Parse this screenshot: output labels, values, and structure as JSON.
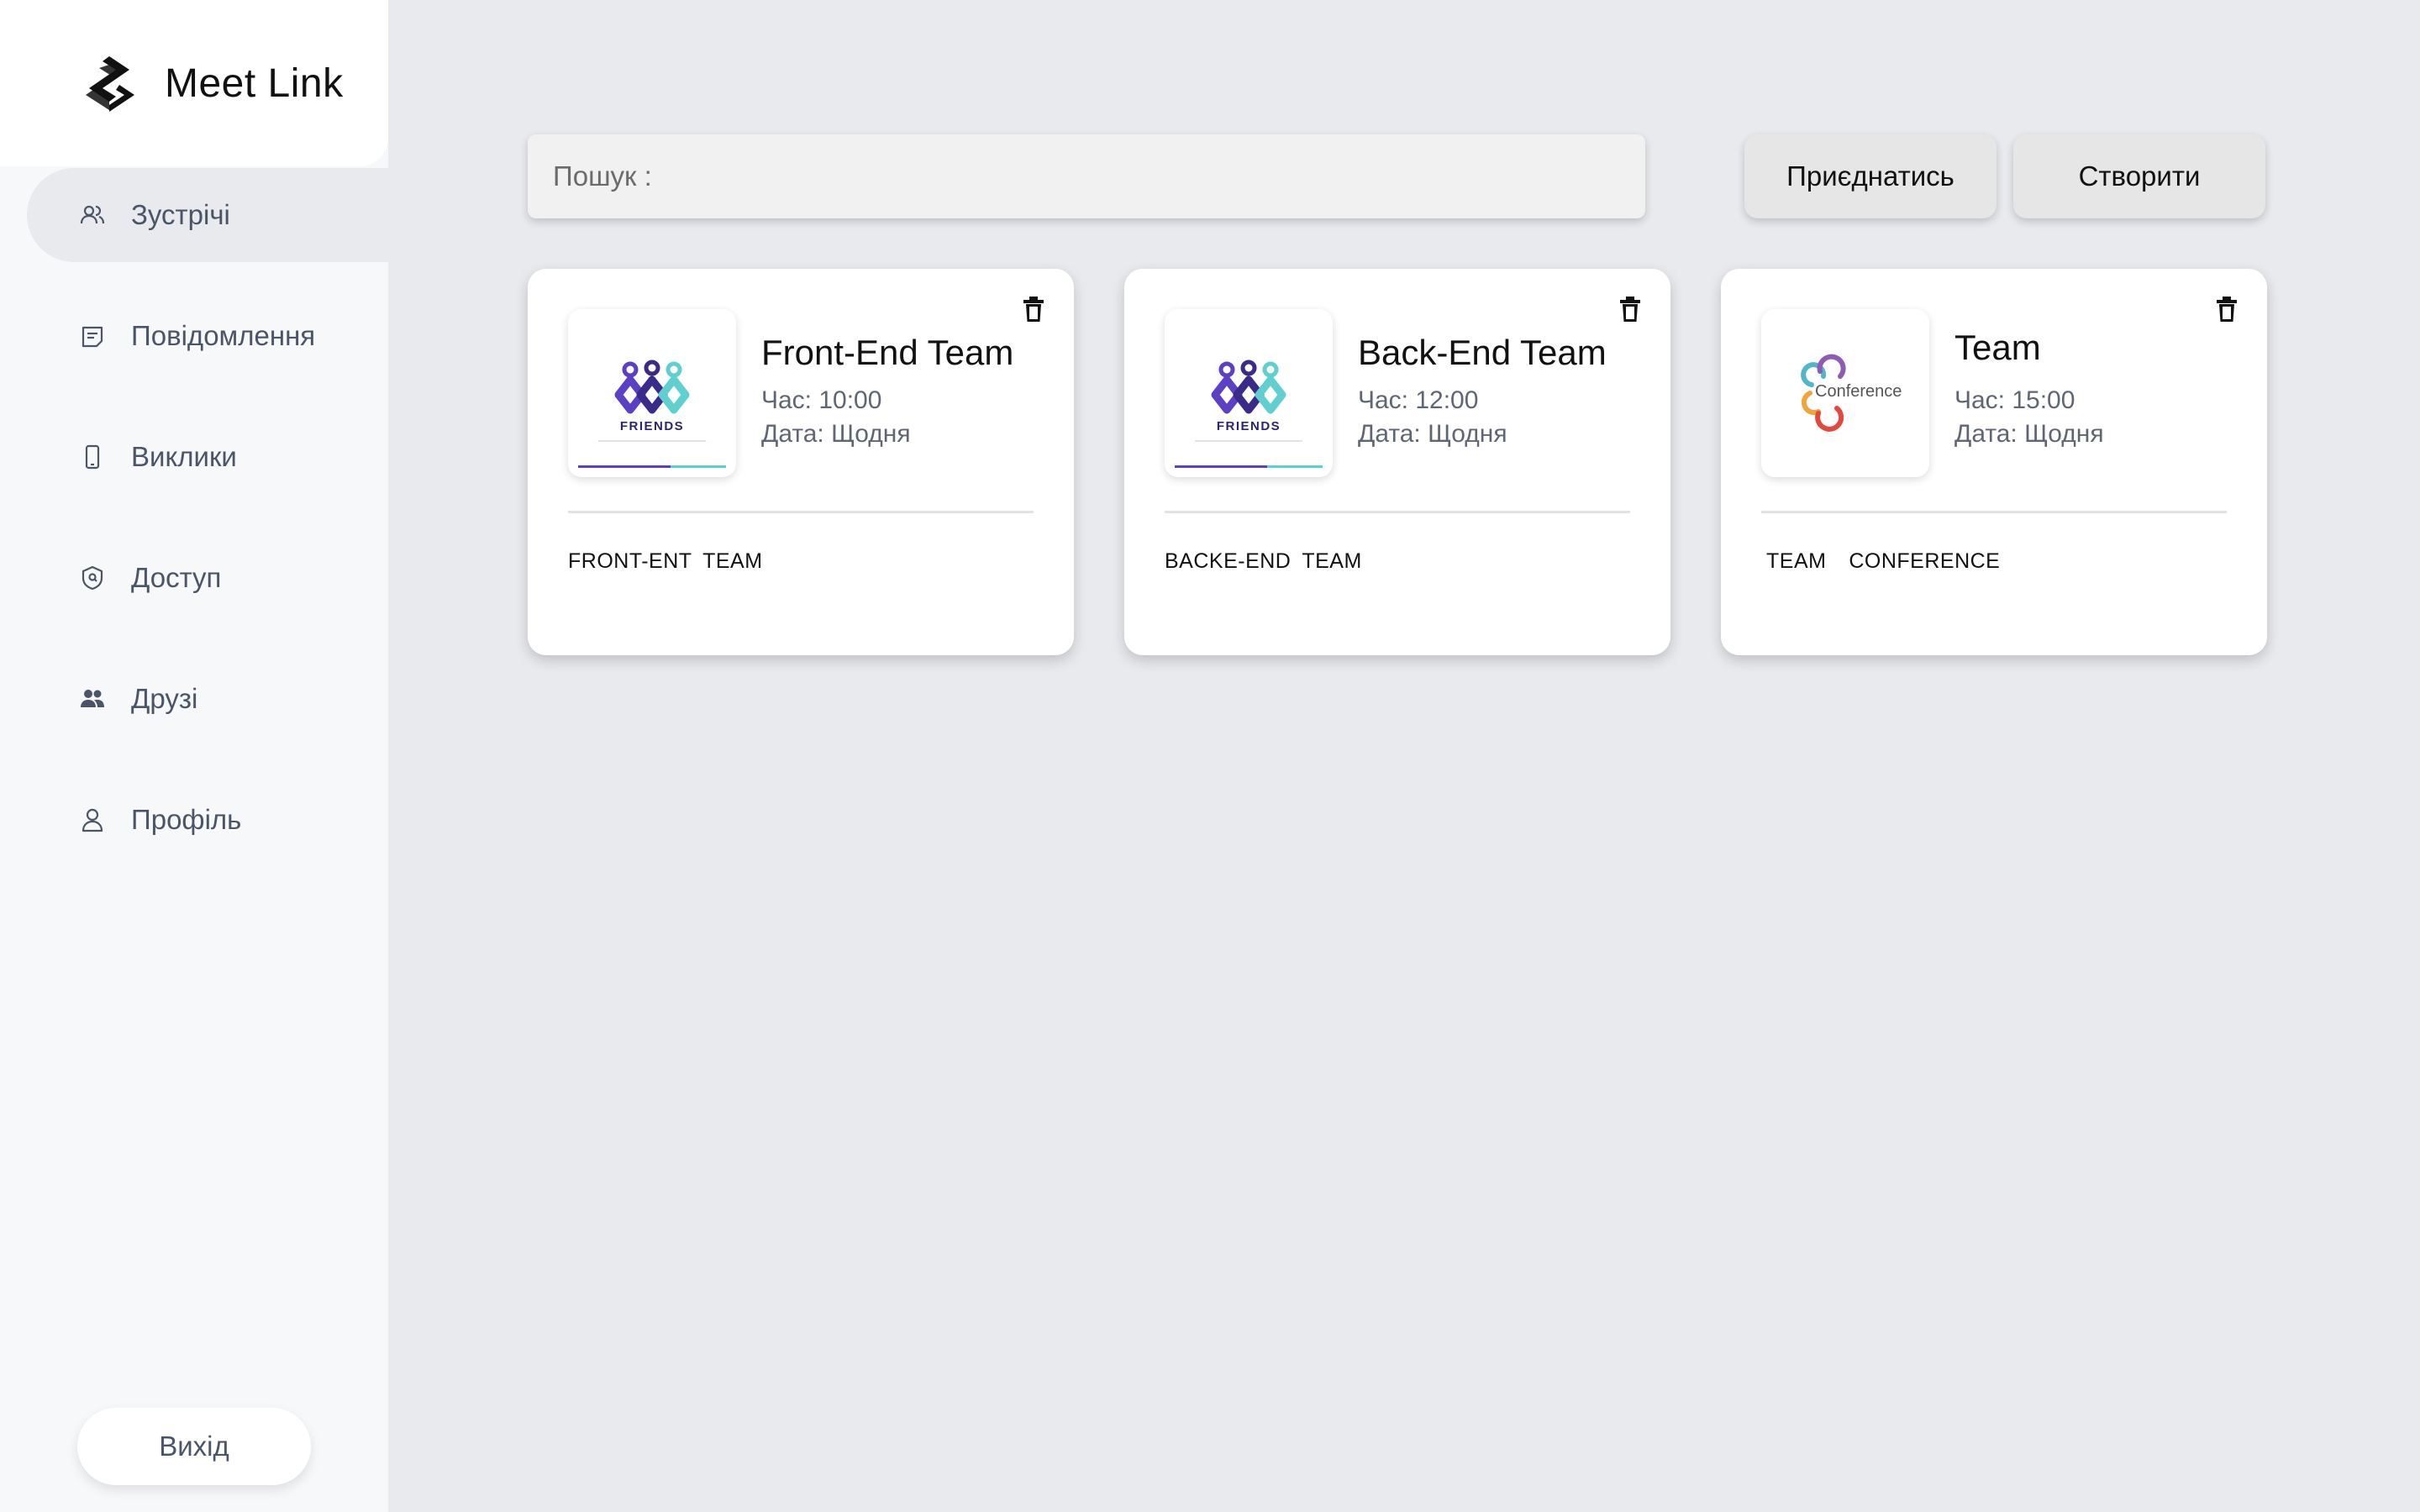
{
  "app": {
    "name": "Meet Link",
    "logo_icon": "meet-link-logo"
  },
  "sidebar": {
    "items": [
      {
        "label": "Зустрічі",
        "icon": "people-outline-icon",
        "active": true
      },
      {
        "label": "Повідомлення",
        "icon": "message-icon",
        "active": false
      },
      {
        "label": "Виклики",
        "icon": "phone-icon",
        "active": false
      },
      {
        "label": "Доступ",
        "icon": "shield-icon",
        "active": false
      },
      {
        "label": "Друзі",
        "icon": "people-filled-icon",
        "active": false
      },
      {
        "label": "Профіль",
        "icon": "person-icon",
        "active": false
      }
    ],
    "logout_label": "Вихід"
  },
  "toolbar": {
    "search_label": "Пошук :",
    "search_value": "",
    "join_label": "Приєднатись",
    "create_label": "Створити"
  },
  "meetings": [
    {
      "title": "Front-End Team",
      "time": "Час: 10:00",
      "date": "Дата: Щодня",
      "description": "FRONT-ENT TEAM",
      "image": "friends-logo",
      "image_text": "FRIENDS"
    },
    {
      "title": "Back-End Team",
      "time": "Час: 12:00",
      "date": "Дата: Щодня",
      "description": "BACKE-END TEAM",
      "image": "friends-logo",
      "image_text": "FRIENDS"
    },
    {
      "title": "Team",
      "time": "Час: 15:00",
      "date": "Дата: Щодня",
      "description": "TEAM  CONFERENCE",
      "image": "conference-logo",
      "image_text": "Conference"
    }
  ],
  "colors": {
    "background": "#e8eaee",
    "sidebar": "#f7f8fa",
    "nav_text": "#4a5568",
    "friends_purple": "#5b3fc4",
    "friends_teal": "#5fcfd0"
  }
}
